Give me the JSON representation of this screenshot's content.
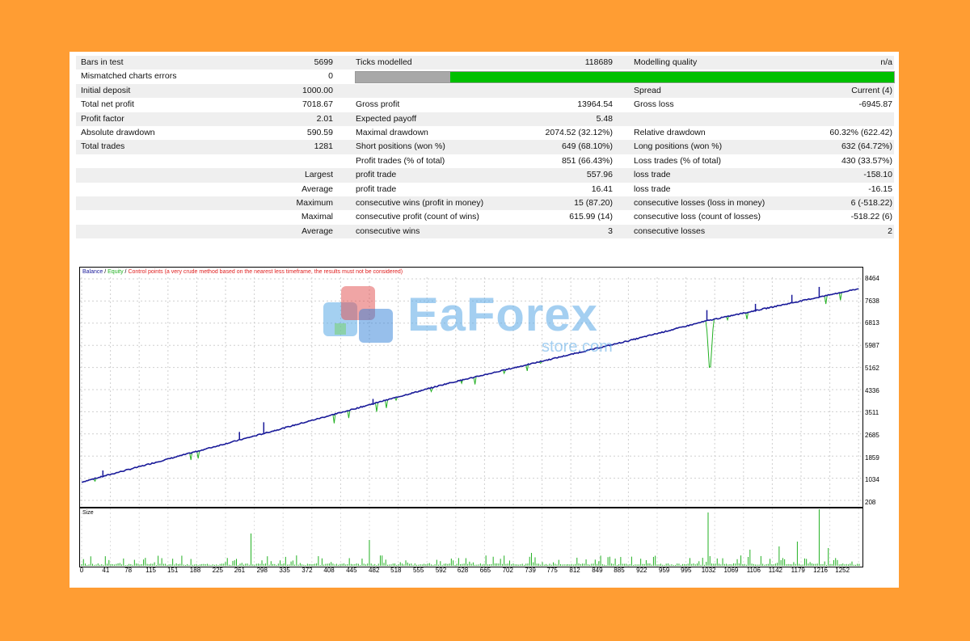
{
  "stats": {
    "rows": [
      {
        "l1": "Bars in test",
        "v1": "5699",
        "l2": "Ticks modelled",
        "v2": "118689",
        "l3": "Modelling quality",
        "v3": "n/a"
      },
      {
        "l1": "Mismatched charts errors",
        "v1": "0",
        "l2": "",
        "v2": "",
        "l3": "",
        "v3": ""
      },
      {
        "l1": "Initial deposit",
        "v1": "1000.00",
        "l2": "",
        "v2": "",
        "l3": "Spread",
        "v3": "Current (4)"
      },
      {
        "l1": "Total net profit",
        "v1": "7018.67",
        "l2": "Gross profit",
        "v2": "13964.54",
        "l3": "Gross loss",
        "v3": "-6945.87"
      },
      {
        "l1": "Profit factor",
        "v1": "2.01",
        "l2": "Expected payoff",
        "v2": "5.48",
        "l3": "",
        "v3": ""
      },
      {
        "l1": "Absolute drawdown",
        "v1": "590.59",
        "l2": "Maximal drawdown",
        "v2": "2074.52 (32.12%)",
        "l3": "Relative drawdown",
        "v3": "60.32% (622.42)"
      },
      {
        "l1": "Total trades",
        "v1": "1281",
        "l2": "Short positions (won %)",
        "v2": "649 (68.10%)",
        "l3": "Long positions (won %)",
        "v3": "632 (64.72%)"
      },
      {
        "l1": "",
        "v1": "",
        "l2": "Profit trades (% of total)",
        "v2": "851 (66.43%)",
        "l3": "Loss trades (% of total)",
        "v3": "430 (33.57%)"
      },
      {
        "l1": "",
        "v1": "Largest",
        "l2": "profit trade",
        "v2": "557.96",
        "l3": "loss trade",
        "v3": "-158.10"
      },
      {
        "l1": "",
        "v1": "Average",
        "l2": "profit trade",
        "v2": "16.41",
        "l3": "loss trade",
        "v3": "-16.15"
      },
      {
        "l1": "",
        "v1": "Maximum",
        "l2": "consecutive wins (profit in money)",
        "v2": "15 (87.20)",
        "l3": "consecutive losses (loss in money)",
        "v3": "6 (-518.22)"
      },
      {
        "l1": "",
        "v1": "Maximal",
        "l2": "consecutive profit (count of wins)",
        "v2": "615.99 (14)",
        "l3": "consecutive loss (count of losses)",
        "v3": "-518.22 (6)"
      },
      {
        "l1": "",
        "v1": "Average",
        "l2": "consecutive wins",
        "v2": "3",
        "l3": "consecutive losses",
        "v3": "2"
      }
    ],
    "modelling_quality_fraction": 0.176
  },
  "legend": {
    "balance": "Balance",
    "sep1": " / ",
    "equity": "Equity",
    "sep2": " / ",
    "control": "Control points (a very crude method based on the nearest less timeframe, the results must not be considered)"
  },
  "size_label": "Size",
  "watermark": {
    "brand": "EaForex",
    "sub": "store.com"
  },
  "colors": {
    "balance": "#1a1a9a",
    "equity": "#22b022",
    "control": "#e02020",
    "quality_bar": "#00c000",
    "quality_gray": "#a8a8a8",
    "background": "#ff9d33"
  },
  "chart_data": [
    {
      "type": "line",
      "title": "",
      "series": [
        {
          "name": "Balance",
          "x": [
            0,
            300,
            600,
            900,
            1030,
            1281
          ],
          "values": [
            890,
            2700,
            4550,
            6150,
            6900,
            8100
          ]
        },
        {
          "name": "Equity",
          "x": [
            0,
            300,
            600,
            900,
            1030,
            1040,
            1281
          ],
          "values": [
            890,
            2700,
            4550,
            6150,
            6900,
            4800,
            8100
          ]
        }
      ],
      "yticks": [
        "8464",
        "7638",
        "6813",
        "5987",
        "5162",
        "4336",
        "3511",
        "2685",
        "1859",
        "1034",
        "208"
      ],
      "ylim": [
        208,
        8464
      ]
    },
    {
      "type": "bar",
      "title": "",
      "series_name": "Size",
      "xticks": [
        "0",
        "41",
        "78",
        "115",
        "151",
        "188",
        "225",
        "261",
        "298",
        "335",
        "372",
        "408",
        "445",
        "482",
        "518",
        "555",
        "592",
        "628",
        "665",
        "702",
        "739",
        "775",
        "812",
        "849",
        "885",
        "922",
        "959",
        "995",
        "1032",
        "1069",
        "1106",
        "1142",
        "1179",
        "1216",
        "1252"
      ],
      "xlim": [
        0,
        1281
      ]
    }
  ]
}
